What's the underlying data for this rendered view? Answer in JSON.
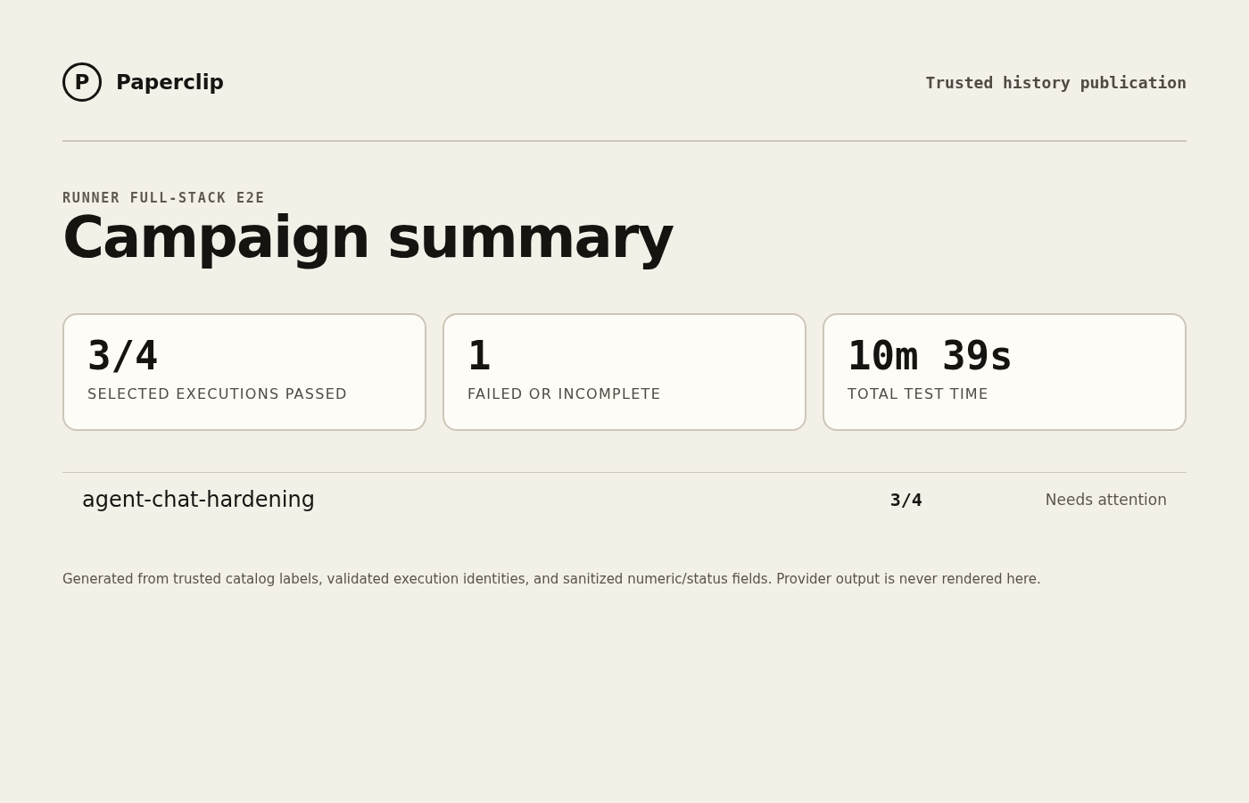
{
  "header": {
    "logo_letter": "P",
    "brand": "Paperclip",
    "tagline": "Trusted history publication"
  },
  "page": {
    "eyebrow": "RUNNER FULL-STACK E2E",
    "title": "Campaign summary"
  },
  "stats": [
    {
      "value": "3/4",
      "label": "SELECTED EXECUTIONS PASSED"
    },
    {
      "value": "1",
      "label": "FAILED OR INCOMPLETE"
    },
    {
      "value": "10m 39s",
      "label": "TOTAL TEST TIME"
    }
  ],
  "campaigns": [
    {
      "name": "agent-chat-hardening",
      "passed": "3/4",
      "status": "Needs attention"
    }
  ],
  "footer": {
    "note": "Generated from trusted catalog labels, validated execution identities, and sanitized numeric/status fields. Provider output is never rendered here."
  }
}
